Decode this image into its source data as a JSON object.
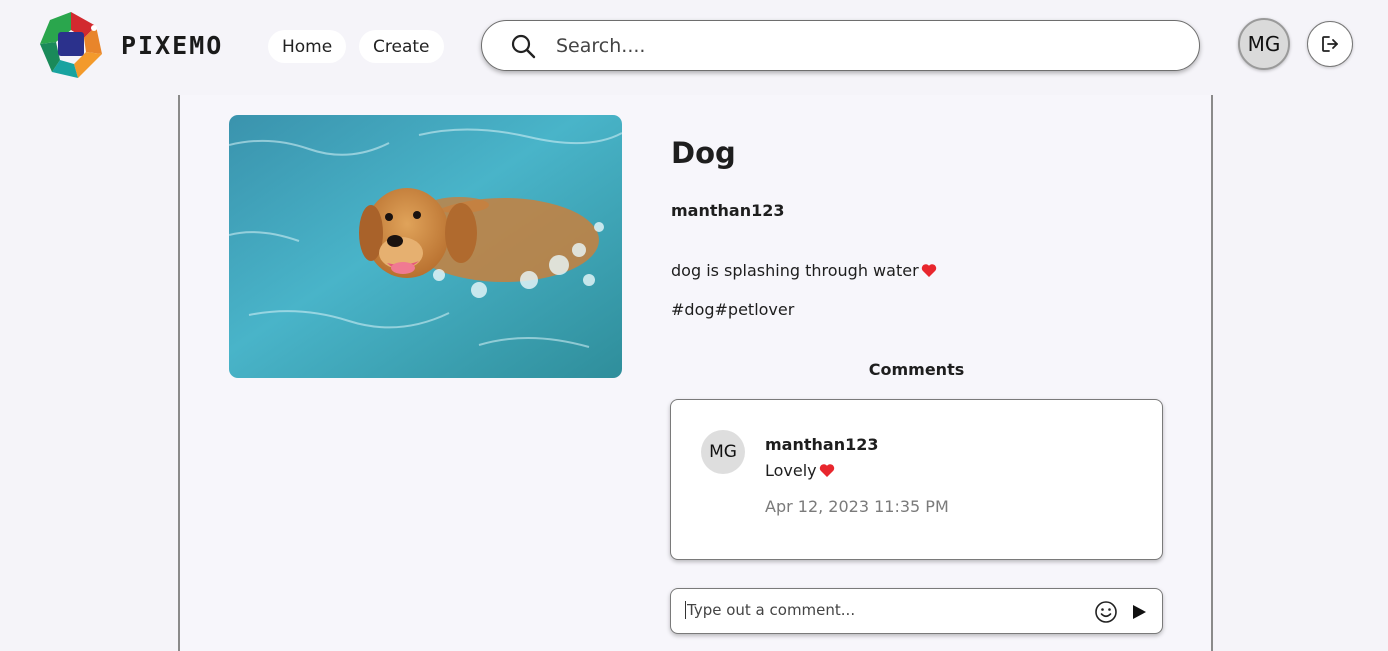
{
  "header": {
    "brand": "PIXEMO",
    "nav": {
      "home_label": "Home",
      "create_label": "Create"
    },
    "search": {
      "placeholder": "Search...."
    },
    "user_initials": "MG"
  },
  "post": {
    "title": "Dog",
    "author": "manthan123",
    "description": "dog is splashing through water",
    "tags": "#dog#petlover",
    "image_alt": "dog swimming in water"
  },
  "comments": {
    "heading": "Comments",
    "items": [
      {
        "initials": "MG",
        "user": "manthan123",
        "text": "Lovely",
        "timestamp": "Apr 12, 2023 11:35 PM"
      }
    ],
    "input_placeholder": "Type out a comment..."
  },
  "colors": {
    "background": "#f5f4f9",
    "heart": "#e8262d",
    "logo_red": "#d22a2f",
    "logo_green": "#1a8a5a",
    "logo_teal": "#1aa3a3",
    "logo_orange": "#f39a2b",
    "logo_navy": "#2a2f8a"
  },
  "icons": {
    "search": "search-icon",
    "logout": "logout-icon",
    "emoji": "emoji-icon",
    "send": "send-icon",
    "heart": "heart-icon"
  }
}
